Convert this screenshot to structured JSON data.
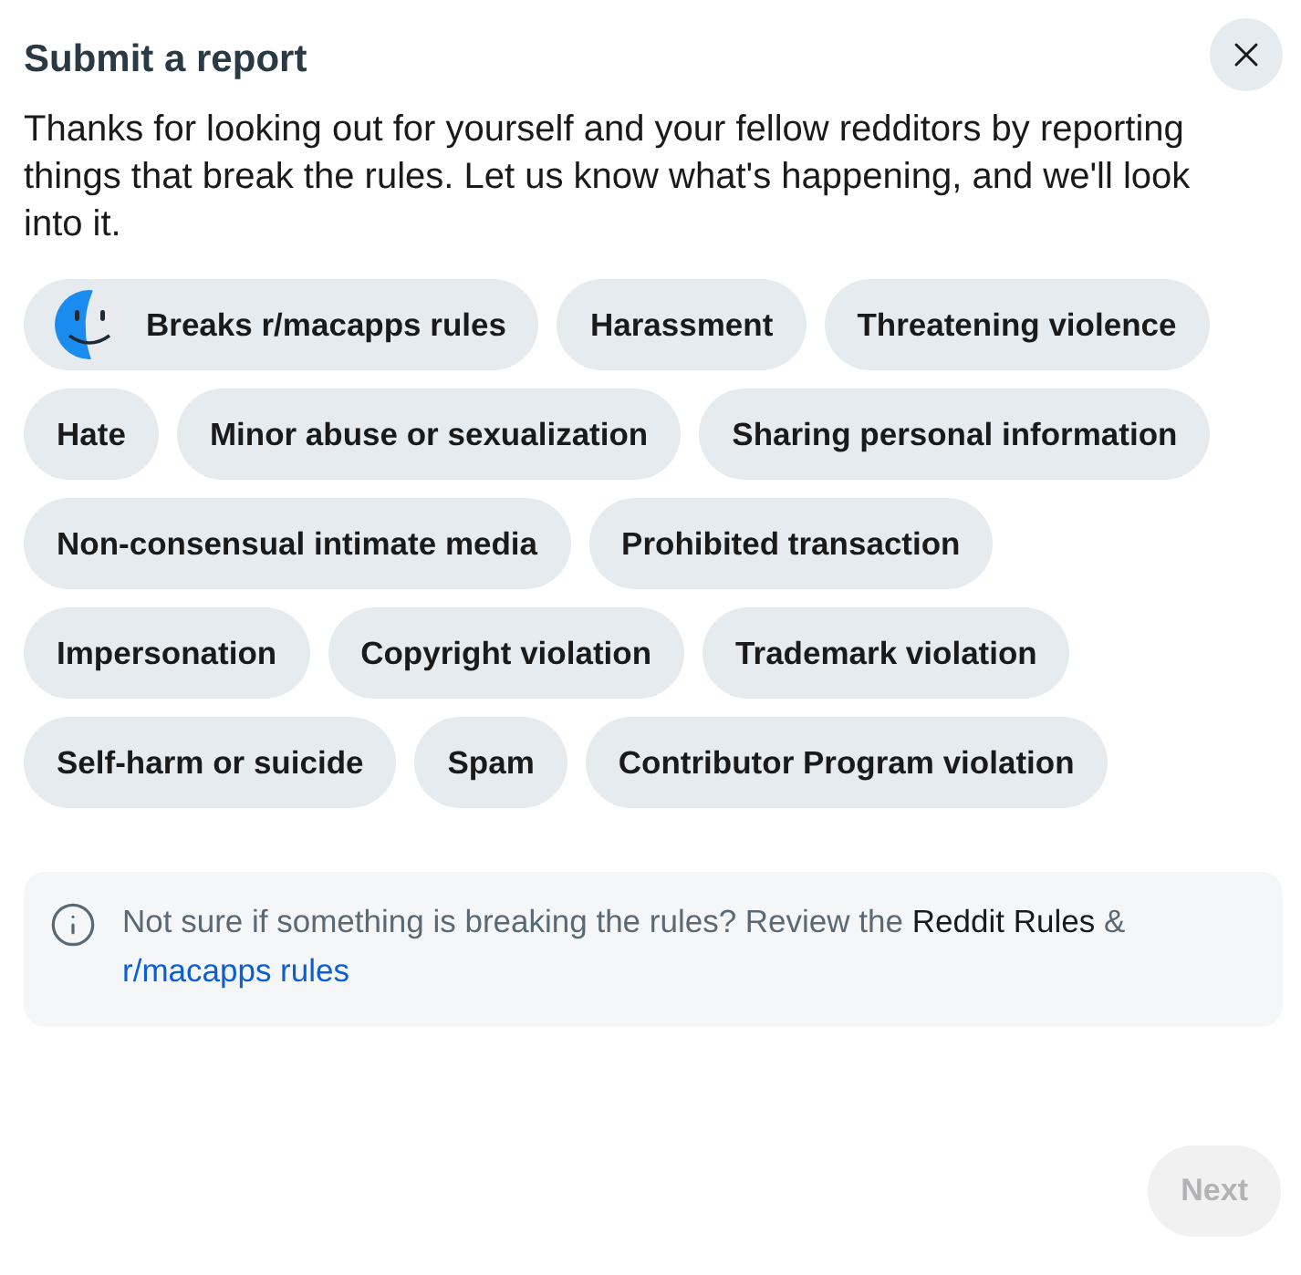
{
  "dialog": {
    "title": "Submit a report",
    "intro": "Thanks for looking out for yourself and your fellow redditors by reporting things that break the rules. Let us know what's happening, and we'll look into it."
  },
  "reasons": [
    {
      "kind": "community",
      "label": "Breaks r/macapps rules",
      "selected": false
    },
    {
      "kind": "plain",
      "label": "Harassment",
      "selected": false
    },
    {
      "kind": "plain",
      "label": "Threatening violence",
      "selected": false
    },
    {
      "kind": "plain",
      "label": "Hate",
      "selected": false
    },
    {
      "kind": "plain",
      "label": "Minor abuse or sexualization",
      "selected": false
    },
    {
      "kind": "plain",
      "label": "Sharing personal information",
      "selected": false
    },
    {
      "kind": "plain",
      "label": "Non-consensual intimate media",
      "selected": false
    },
    {
      "kind": "plain",
      "label": "Prohibited transaction",
      "selected": false
    },
    {
      "kind": "plain",
      "label": "Impersonation",
      "selected": false
    },
    {
      "kind": "plain",
      "label": "Copyright violation",
      "selected": false
    },
    {
      "kind": "plain",
      "label": "Trademark violation",
      "selected": false
    },
    {
      "kind": "plain",
      "label": "Self-harm or suicide",
      "selected": false
    },
    {
      "kind": "plain",
      "label": "Spam",
      "selected": false
    },
    {
      "kind": "plain",
      "label": "Contributor Program violation",
      "selected": false
    }
  ],
  "notice": {
    "text": "Not sure if something is breaking the rules? Review the",
    "site_rules_link": "Reddit Rules",
    "joiner": "&",
    "community_rules_link": "r/macapps rules"
  },
  "next_button": {
    "label": "Next",
    "disabled": true
  }
}
